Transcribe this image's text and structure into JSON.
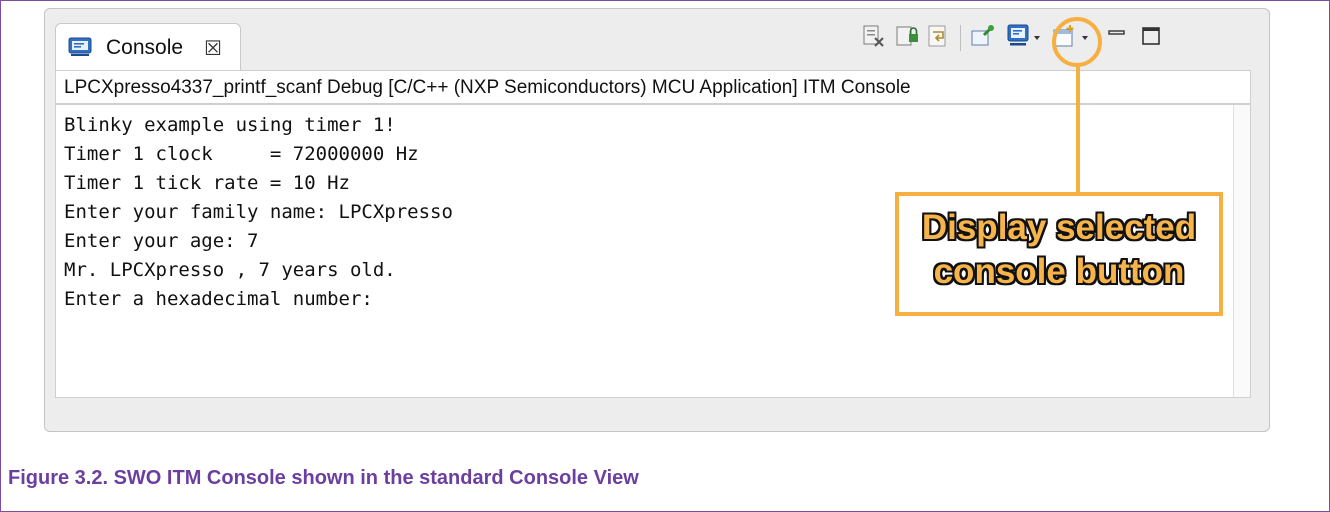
{
  "tab": {
    "label": "Console",
    "close_glyph": "☒",
    "icon": "console-icon"
  },
  "toolbar": {
    "buttons": [
      {
        "icon": "clear-console-icon"
      },
      {
        "icon": "scroll-lock-icon"
      },
      {
        "icon": "word-wrap-icon"
      },
      {
        "icon": "pin-console-icon"
      },
      {
        "icon": "display-selected-console-icon"
      },
      {
        "icon": "open-console-icon"
      },
      {
        "icon": "minimize-icon"
      },
      {
        "icon": "maximize-icon"
      }
    ]
  },
  "console": {
    "header": "LPCXpresso4337_printf_scanf Debug [C/C++ (NXP Semiconductors) MCU Application] ITM Console",
    "lines": [
      "Blinky example using timer 1!",
      "Timer 1 clock     = 72000000 Hz",
      "Timer 1 tick rate = 10 Hz",
      "Enter your family name: LPCXpresso",
      "Enter your age: 7",
      "Mr. LPCXpresso , 7 years old.",
      "Enter a hexadecimal number:"
    ]
  },
  "annotation": {
    "line1": "Display selected",
    "line2": "console button",
    "color": "#f5b041"
  },
  "caption": "Figure 3.2. SWO ITM Console shown in the standard Console View"
}
